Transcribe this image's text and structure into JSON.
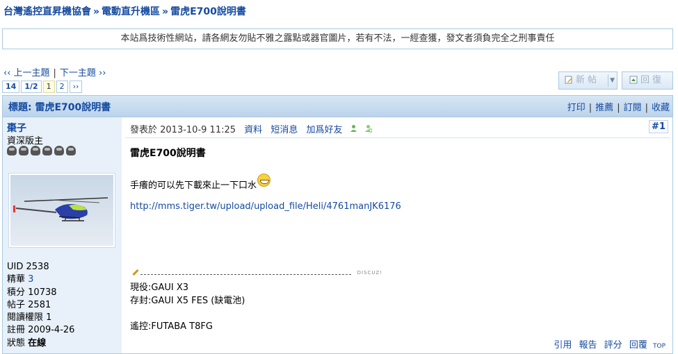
{
  "breadcrumb": {
    "site": "台灣遙控直昇機協會",
    "section": "電動直升機區",
    "thread": "雷虎E700說明書",
    "separator": "»"
  },
  "notice": "本站爲技術性網站，請各網友勿貼不雅之露點或器官圖片，若有不法，一經查獲，發文者須負完全之刑事責任",
  "thread_nav": {
    "prev": "‹‹ 上一主題",
    "next": "下一主題 ››"
  },
  "pagination": {
    "total": "14",
    "pages": "1/2",
    "current": "1",
    "page2": "2",
    "next": "››"
  },
  "buttons": {
    "new_post": "新帖",
    "reply": "回復"
  },
  "title_bar": {
    "title": "標題: 雷虎E700說明書",
    "print": "打印",
    "recommend": "推薦",
    "subscribe": "訂閱",
    "favorite": "收藏"
  },
  "author": {
    "name": "棗子",
    "rank": "資深版主",
    "uid_label": "UID",
    "uid": "2538",
    "digest_label": "精華",
    "digest": "3",
    "points_label": "積分",
    "points": "10738",
    "posts_label": "帖子",
    "posts": "2581",
    "permission_label": "閱讀權限",
    "permission": "1",
    "registered_label": "註冊",
    "registered": "2009-4-26",
    "status_label": "狀態",
    "status": "在線"
  },
  "post_meta": {
    "posted_at": "發表於 2013-10-9 11:25",
    "profile": "資料",
    "message": "短消息",
    "add_friend": "加爲好友",
    "floor": "#1"
  },
  "post": {
    "subject": "雷虎E700說明書",
    "body": "手癢的可以先下載來止一下口水",
    "link": "http://mms.tiger.tw/upload/upload_file/Heli/4761manJK6176",
    "sig_mark": "DISCUZ!",
    "signature": [
      "現役:GAUI X3",
      "存封:GAUI X5 FES (缺電池)",
      "",
      "遙控:FUTABA T8FG"
    ]
  },
  "post_actions": {
    "quote": "引用",
    "report": "報告",
    "rate": "評分",
    "reply": "回覆",
    "top": "TOP"
  },
  "colors": {
    "link": "#154ba0",
    "border": "#a9c9e2",
    "author_bg": "#e8f1fa"
  }
}
